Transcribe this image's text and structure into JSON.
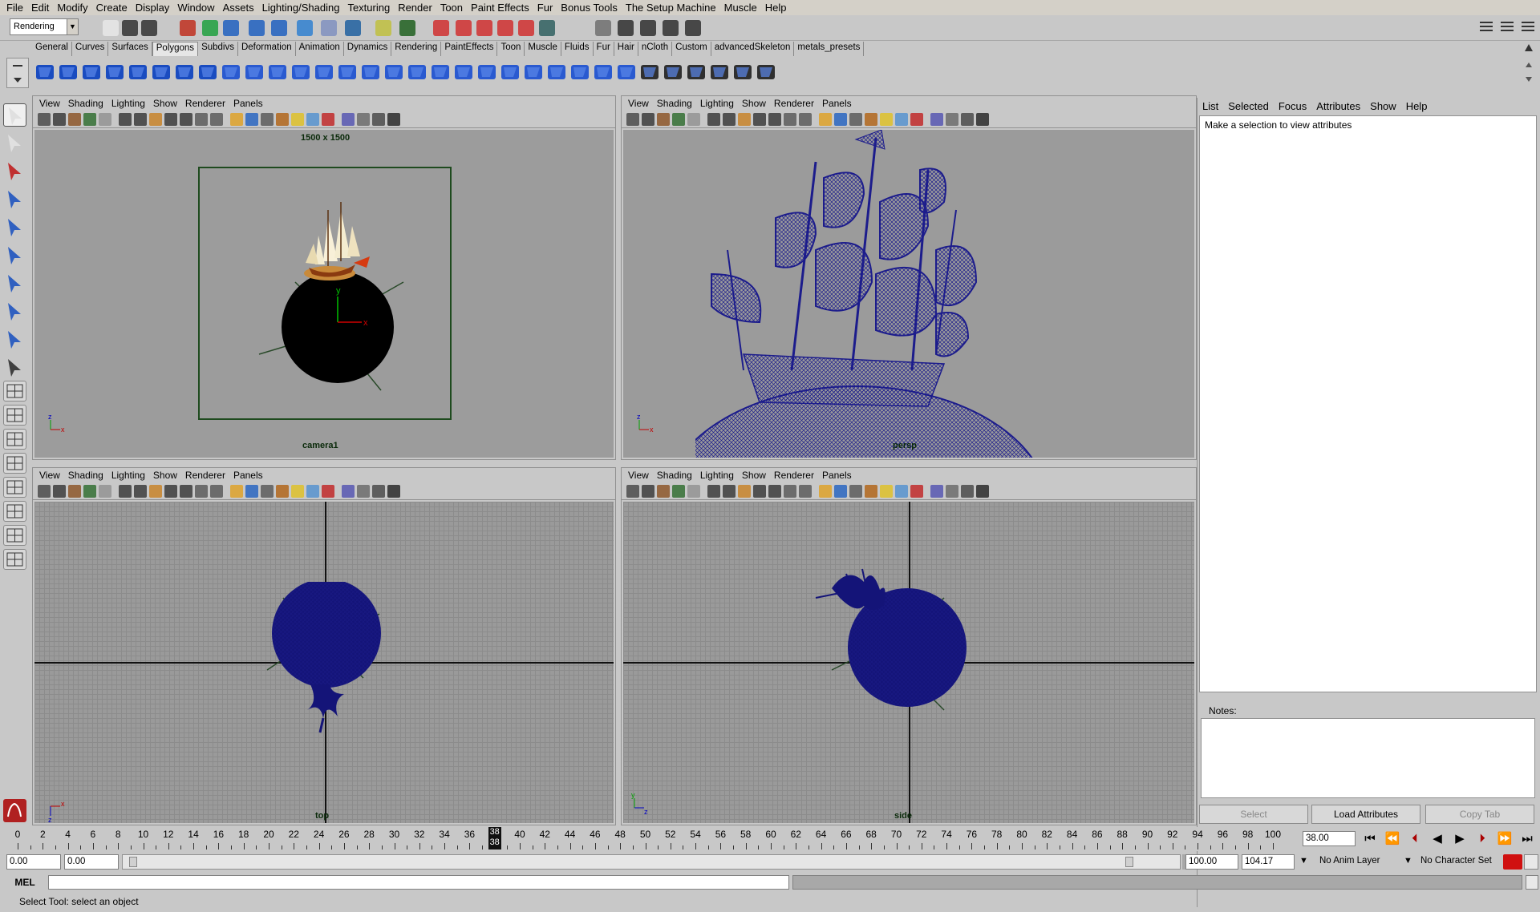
{
  "menubar": [
    "File",
    "Edit",
    "Modify",
    "Create",
    "Display",
    "Window",
    "Assets",
    "Lighting/Shading",
    "Texturing",
    "Render",
    "Toon",
    "Paint Effects",
    "Fur",
    "Bonus Tools",
    "The Setup Machine",
    "Muscle",
    "Help"
  ],
  "status": {
    "menuset": "Rendering"
  },
  "shelf_tabs": [
    "General",
    "Curves",
    "Surfaces",
    "Polygons",
    "Subdivs",
    "Deformation",
    "Animation",
    "Dynamics",
    "Rendering",
    "PaintEffects",
    "Toon",
    "Muscle",
    "Fluids",
    "Fur",
    "Hair",
    "nCloth",
    "Custom",
    "advancedSkeleton",
    "metals_presets"
  ],
  "shelf_active": "Polygons",
  "panel_menu": [
    "View",
    "Shading",
    "Lighting",
    "Show",
    "Renderer",
    "Panels"
  ],
  "viewports": {
    "camera": {
      "resolution": "1500 x 1500",
      "name": "camera1"
    },
    "persp": {
      "name": "persp"
    },
    "top": {
      "name": "top"
    },
    "side": {
      "name": "side"
    }
  },
  "attribute_editor": {
    "menu": [
      "List",
      "Selected",
      "Focus",
      "Attributes",
      "Show",
      "Help"
    ],
    "message": "Make a selection to view attributes",
    "notes_label": "Notes:",
    "buttons": {
      "select": "Select",
      "load": "Load Attributes",
      "copy": "Copy Tab"
    }
  },
  "timeline": {
    "labels": [
      "0",
      "2",
      "4",
      "6",
      "8",
      "10",
      "12",
      "14",
      "16",
      "18",
      "20",
      "22",
      "24",
      "26",
      "28",
      "30",
      "32",
      "34",
      "36",
      "38",
      "40",
      "42",
      "44",
      "46",
      "48",
      "50",
      "52",
      "54",
      "56",
      "58",
      "60",
      "62",
      "64",
      "66",
      "68",
      "70",
      "72",
      "74",
      "76",
      "78",
      "80",
      "82",
      "84",
      "86",
      "88",
      "90",
      "92",
      "94",
      "96",
      "98",
      "100"
    ],
    "current_frame": "38",
    "current_field": "38.00"
  },
  "range": {
    "start": "0.00",
    "anim_start": "0.00",
    "anim_end": "100.00",
    "end": "104.17",
    "anim_layer": "No Anim Layer",
    "char_set": "No Character Set"
  },
  "commandline": {
    "label": "MEL"
  },
  "helpline": {
    "text": "Select Tool: select an object"
  }
}
